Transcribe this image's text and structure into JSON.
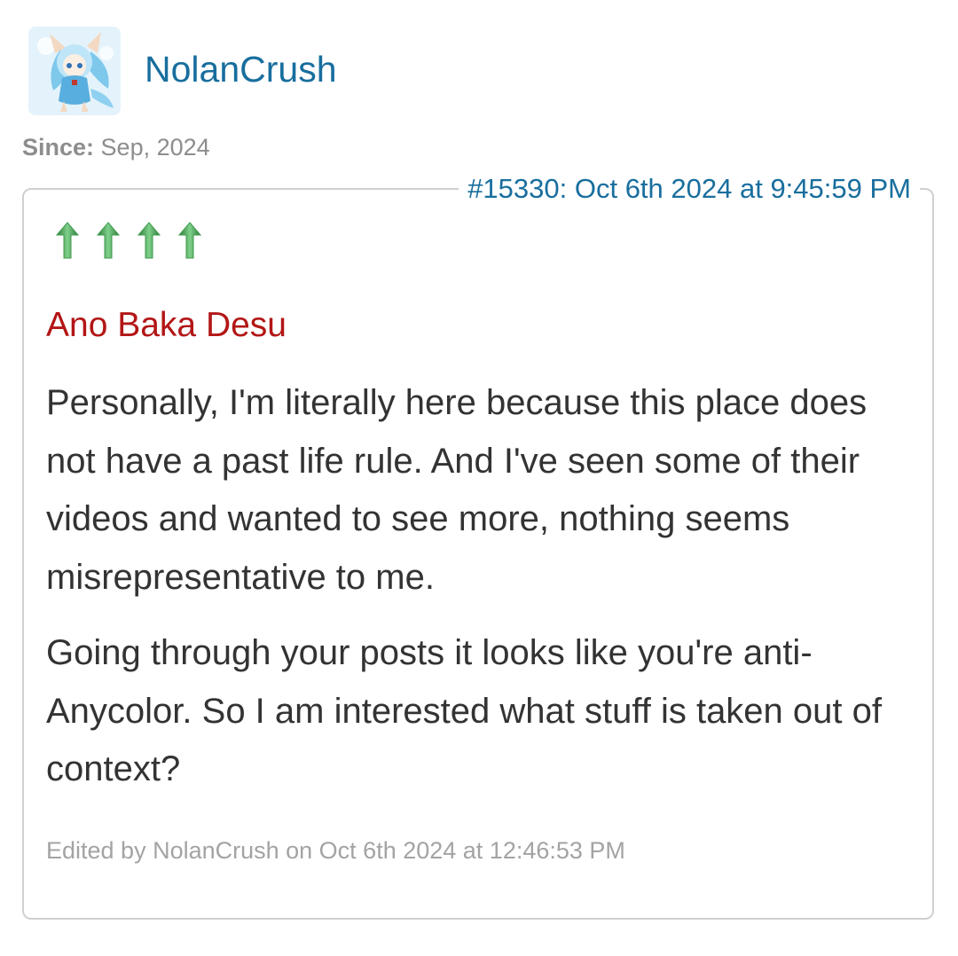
{
  "author": {
    "username": "NolanCrush",
    "since_label": "Since:",
    "since_value": "Sep, 2024"
  },
  "post": {
    "meta": "#15330: Oct 6th 2024 at 9:45:59 PM",
    "vote_arrow_count": 4,
    "quote_author": "Ano Baka Desu",
    "paragraphs": [
      "Personally, I'm literally here because this place does not have a past life rule. And I've seen some of their videos and wanted to see more, nothing seems misrepresentative to me.",
      "Going through your posts it looks like you're anti-Anycolor. So I am interested what stuff is taken out of context?"
    ],
    "edited_note": "Edited by NolanCrush on Oct 6th 2024 at 12:46:53 PM"
  },
  "colors": {
    "link": "#186e9e",
    "quote_author": "#b31616",
    "body_text": "#333333",
    "muted": "#8d8d8d",
    "border": "#d0d0d0",
    "arrow_green": "#3f9a4c"
  }
}
